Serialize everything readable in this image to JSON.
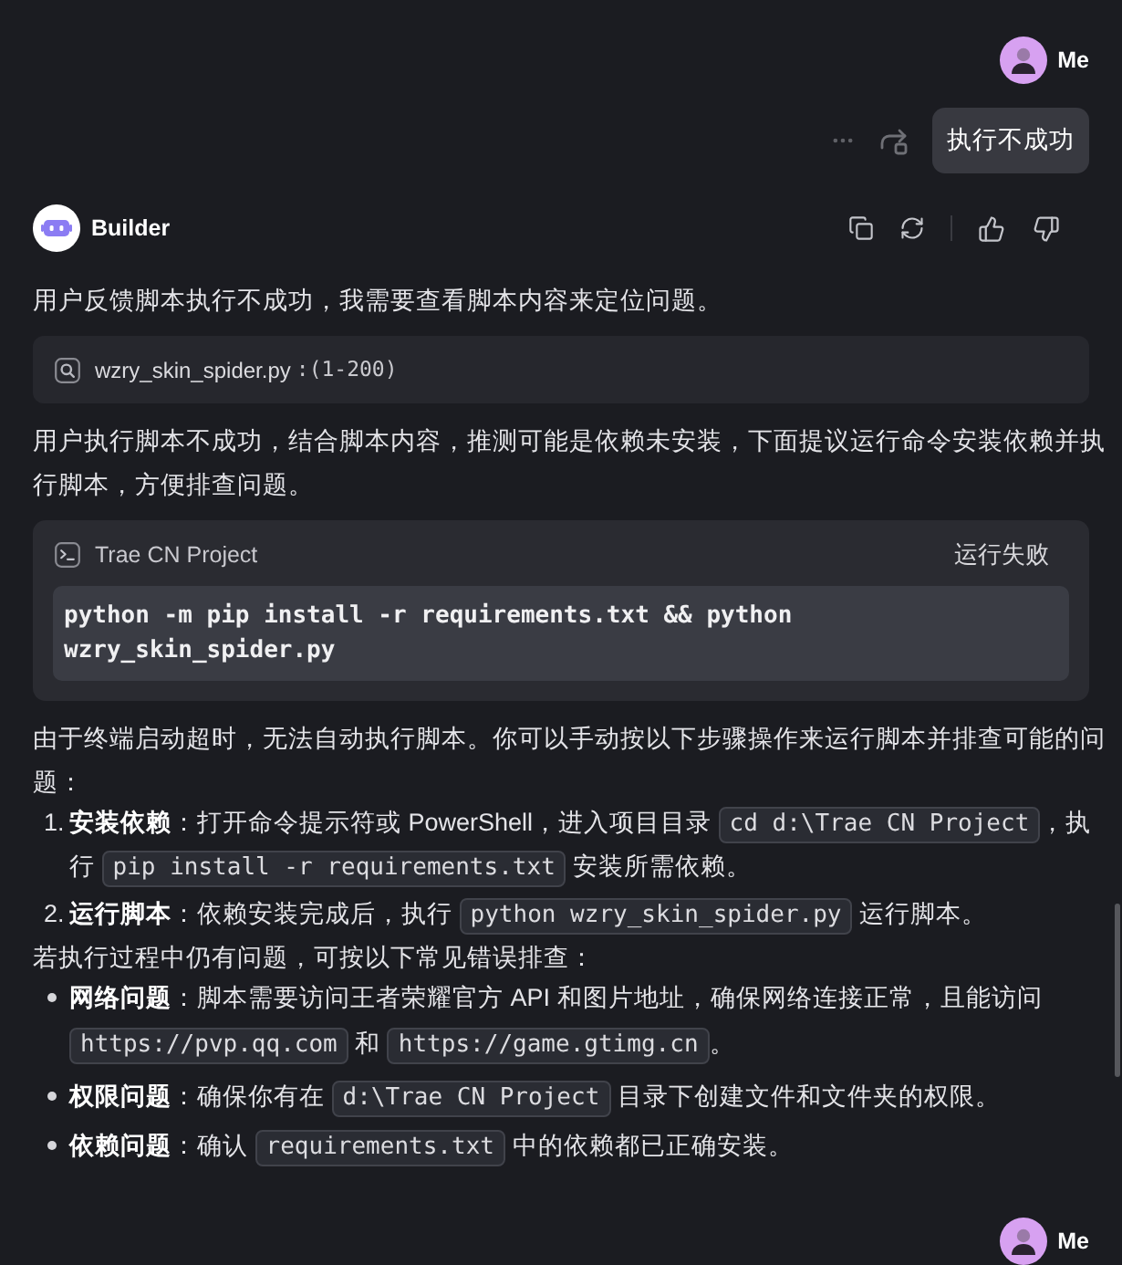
{
  "messages": [
    {
      "kind": "user",
      "author": "Me",
      "text": "执行不成功"
    },
    {
      "kind": "assistant",
      "author": "Builder",
      "blocks": [
        {
          "kind": "paragraph",
          "text": "用户反馈脚本执行不成功，我需要查看脚本内容来定位问题。"
        },
        {
          "kind": "file_ref",
          "file": "wzry_skin_spider.py",
          "range": ":(1-200)"
        },
        {
          "kind": "paragraph",
          "text": "用户执行脚本不成功，结合脚本内容，推测可能是依赖未安装，下面提议运行命令安装依赖并执行脚本，方便排查问题。"
        },
        {
          "kind": "terminal",
          "title": "Trae CN Project",
          "status": "运行失败",
          "command": "python -m pip install -r requirements.txt && python wzry_skin_spider.py"
        },
        {
          "kind": "paragraph",
          "text": "由于终端启动超时，无法自动执行脚本。你可以手动按以下步骤操作来运行脚本并排查可能的问题："
        },
        {
          "kind": "ordered_list",
          "items": [
            {
              "marker": "1.",
              "runs": [
                {
                  "kind": "bold",
                  "text": "安装依赖"
                },
                {
                  "kind": "text",
                  "text": "：打开命令提示符或 PowerShell，进入项目目录 "
                },
                {
                  "kind": "code",
                  "text": "cd d:\\Trae CN Project"
                },
                {
                  "kind": "text",
                  "text": "，执行 "
                },
                {
                  "kind": "code",
                  "text": "pip install -r requirements.txt"
                },
                {
                  "kind": "text",
                  "text": " 安装所需依赖。"
                }
              ]
            },
            {
              "marker": "2.",
              "runs": [
                {
                  "kind": "bold",
                  "text": "运行脚本"
                },
                {
                  "kind": "text",
                  "text": "：依赖安装完成后，执行 "
                },
                {
                  "kind": "code",
                  "text": "python wzry_skin_spider.py"
                },
                {
                  "kind": "text",
                  "text": " 运行脚本。"
                }
              ]
            }
          ]
        },
        {
          "kind": "paragraph",
          "text": "若执行过程中仍有问题，可按以下常见错误排查："
        },
        {
          "kind": "bullet_list",
          "items": [
            {
              "runs": [
                {
                  "kind": "bold",
                  "text": "网络问题"
                },
                {
                  "kind": "text",
                  "text": "：脚本需要访问王者荣耀官方 API 和图片地址，确保网络连接正常，且能访问 "
                },
                {
                  "kind": "code",
                  "text": "https://pvp.qq.com"
                },
                {
                  "kind": "text",
                  "text": " 和 "
                },
                {
                  "kind": "code",
                  "text": "https://game.gtimg.cn"
                },
                {
                  "kind": "text",
                  "text": "。"
                }
              ]
            },
            {
              "runs": [
                {
                  "kind": "bold",
                  "text": "权限问题"
                },
                {
                  "kind": "text",
                  "text": "：确保你有在 "
                },
                {
                  "kind": "code",
                  "text": "d:\\Trae CN Project"
                },
                {
                  "kind": "text",
                  "text": " 目录下创建文件和文件夹的权限。"
                }
              ]
            },
            {
              "runs": [
                {
                  "kind": "bold",
                  "text": "依赖问题"
                },
                {
                  "kind": "text",
                  "text": "：确认 "
                },
                {
                  "kind": "code",
                  "text": "requirements.txt"
                },
                {
                  "kind": "text",
                  "text": " 中的依赖都已正确安装。"
                }
              ]
            }
          ]
        }
      ]
    },
    {
      "kind": "user",
      "author": "Me"
    }
  ]
}
